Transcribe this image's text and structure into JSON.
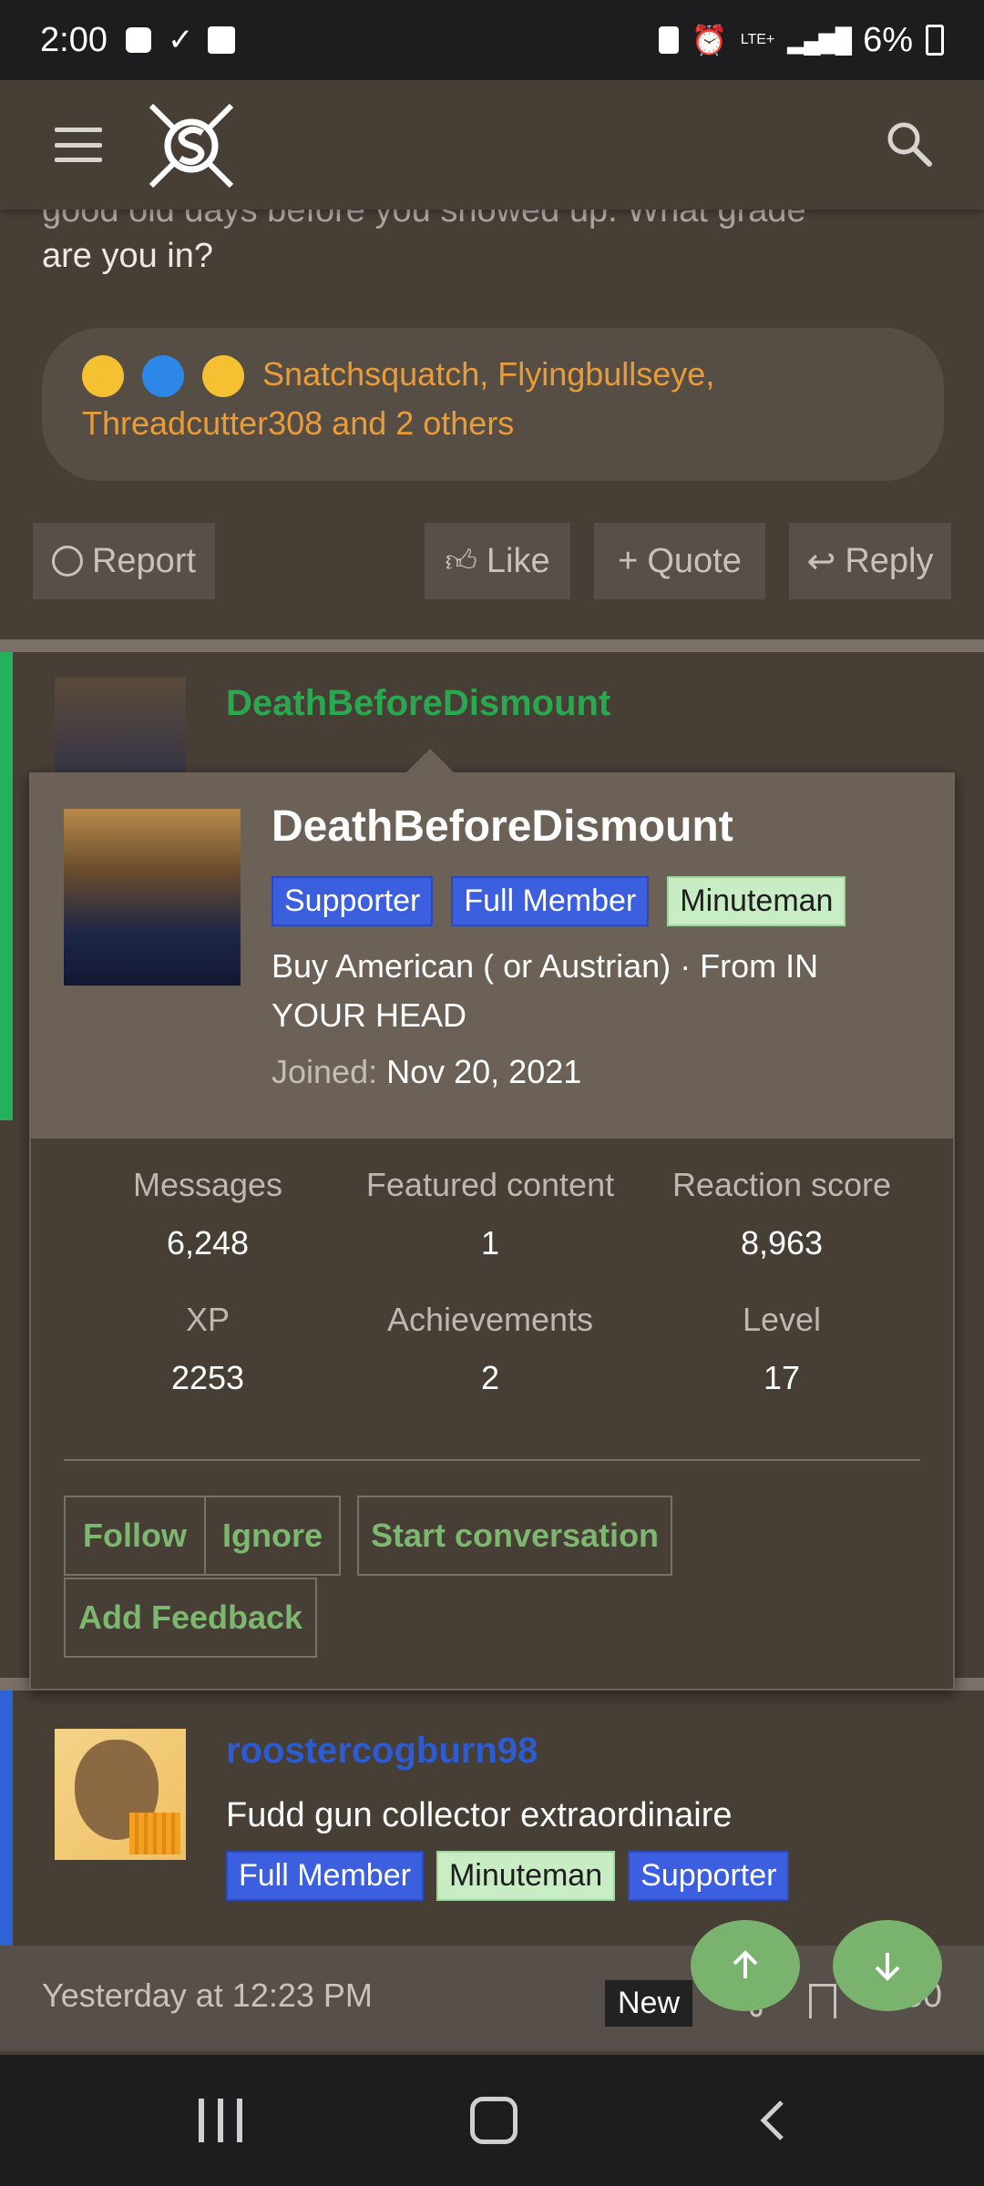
{
  "status_bar": {
    "time": "2:00",
    "battery": "6%",
    "network": "LTE+"
  },
  "post_prev": {
    "text_cut": "good old days before you showed up. What grade",
    "text": "are you in?",
    "reactions_text": "Snatchsquatch, Flyingbullseye, Threadcutter308 and 2 others",
    "actions": {
      "report": "Report",
      "like": "Like",
      "quote": "Quote",
      "reply": "Reply"
    }
  },
  "post_author": {
    "name": "DeathBeforeDismount",
    "desc_cut": "Buy American ( or Austrian)",
    "badge_cut": "Supporter"
  },
  "popover": {
    "name": "DeathBeforeDismount",
    "badges": [
      "Supporter",
      "Full Member",
      "Minuteman"
    ],
    "desc": "Buy American ( or Austrian) · From IN YOUR HEAD",
    "joined_label": "Joined:",
    "joined_value": "Nov 20, 2021",
    "stats": [
      {
        "label": "Messages",
        "value": "6,248"
      },
      {
        "label": "Featured content",
        "value": "1"
      },
      {
        "label": "Reaction score",
        "value": "8,963"
      },
      {
        "label": "XP",
        "value": "2253"
      },
      {
        "label": "Achievements",
        "value": "2"
      },
      {
        "label": "Level",
        "value": "17"
      }
    ],
    "buttons": {
      "follow": "Follow",
      "ignore": "Ignore",
      "start_conversation": "Start conversation",
      "add_feedback": "Add Feedback"
    }
  },
  "next_post": {
    "name": "roostercogburn98",
    "desc": "Fudd gun collector extraordinaire",
    "badges": [
      "Full Member",
      "Minuteman",
      "Supporter"
    ]
  },
  "footer": {
    "time": "Yesterday at 12:23 PM",
    "new_label": "New",
    "post_number": "#50"
  },
  "colors": {
    "accent_green": "#7db870",
    "name_green": "#2aa850",
    "name_blue": "#2d5bd0",
    "reaction_orange": "#e89c3a",
    "fab": "#79b36e"
  }
}
